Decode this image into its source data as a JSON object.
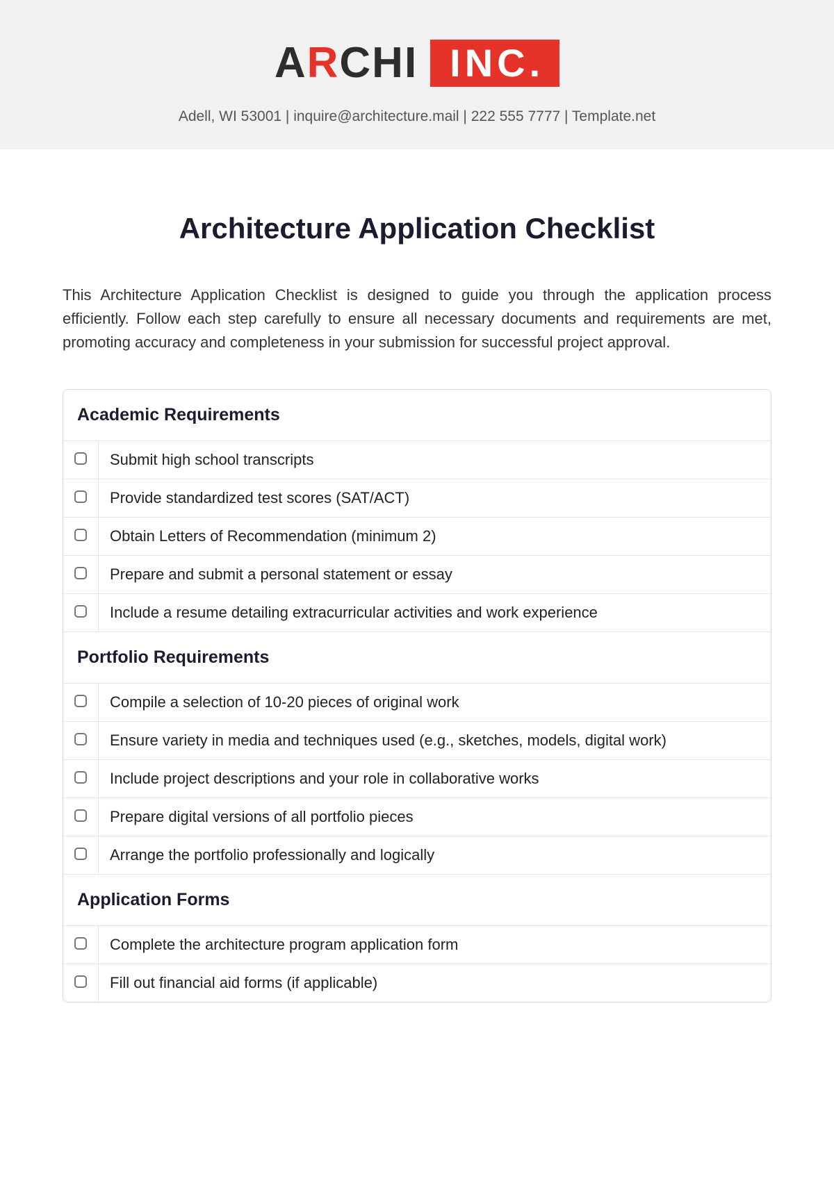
{
  "logo": {
    "archi": "ARCHI",
    "inc": "INC."
  },
  "contact": "Adell, WI 53001 | inquire@architecture.mail | 222 555 7777 | Template.net",
  "title": "Architecture Application Checklist",
  "intro": "This Architecture Application Checklist is designed to guide you through the application process efficiently. Follow each step carefully to ensure all necessary documents and requirements are met, promoting accuracy and completeness in your submission for successful project approval.",
  "sections": [
    {
      "heading": "Academic Requirements",
      "items": [
        "Submit high school transcripts",
        "Provide standardized test scores (SAT/ACT)",
        "Obtain Letters of Recommendation (minimum 2)",
        "Prepare and submit a personal statement or essay",
        "Include a resume detailing extracurricular activities and work experience"
      ]
    },
    {
      "heading": "Portfolio Requirements",
      "items": [
        "Compile a selection of 10-20 pieces of original work",
        "Ensure variety in media and techniques used (e.g., sketches, models, digital work)",
        "Include project descriptions and your role in collaborative works",
        "Prepare digital versions of all portfolio pieces",
        "Arrange the portfolio professionally and logically"
      ]
    },
    {
      "heading": "Application Forms",
      "items": [
        "Complete the architecture program application form",
        "Fill out financial aid forms (if applicable)"
      ]
    }
  ]
}
